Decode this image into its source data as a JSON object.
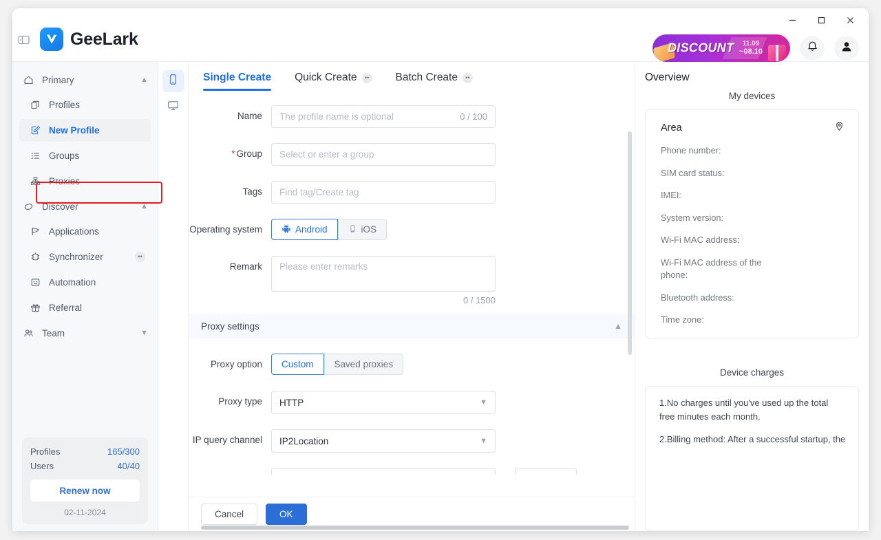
{
  "window": {
    "controls": {
      "minimize": "−",
      "maximize": "□",
      "close": "✕"
    }
  },
  "header": {
    "brand_name": "GeeLark",
    "promo": {
      "word": "DISCOUNT",
      "date_top": "11.09",
      "date_bottom": "~08.10"
    }
  },
  "sidebar": {
    "groups": [
      {
        "label": "Primary",
        "icon": "home-icon",
        "items": [
          {
            "label": "Profiles",
            "icon": "profiles-icon",
            "selected": false,
            "badge": ""
          },
          {
            "label": "New Profile",
            "icon": "new-profile-icon",
            "selected": true,
            "badge": ""
          },
          {
            "label": "Groups",
            "icon": "groups-icon",
            "selected": false,
            "badge": ""
          },
          {
            "label": "Proxies",
            "icon": "proxies-icon",
            "selected": false,
            "badge": ""
          }
        ]
      },
      {
        "label": "Discover",
        "icon": "discover-icon",
        "items": [
          {
            "label": "Applications",
            "icon": "applications-icon",
            "selected": false,
            "badge": ""
          },
          {
            "label": "Synchronizer",
            "icon": "synchronizer-icon",
            "selected": false,
            "badge": "••"
          },
          {
            "label": "Automation",
            "icon": "automation-icon",
            "selected": false,
            "badge": ""
          },
          {
            "label": "Referral",
            "icon": "referral-icon",
            "selected": false,
            "badge": ""
          }
        ]
      }
    ],
    "team": {
      "label": "Team",
      "icon": "team-icon"
    },
    "quota": {
      "profiles_label": "Profiles",
      "profiles_value": "165/300",
      "users_label": "Users",
      "users_value": "40/40",
      "renew_label": "Renew now",
      "date": "02-11-2024"
    }
  },
  "rail": {
    "phone_label": "phone-device",
    "desktop_label": "desktop-device"
  },
  "main": {
    "tabs": [
      {
        "label": "Single Create",
        "badge": "",
        "active": true
      },
      {
        "label": "Quick Create",
        "badge": "••",
        "active": false
      },
      {
        "label": "Batch Create",
        "badge": "••",
        "active": false
      }
    ],
    "fields": {
      "name": {
        "label": "Name",
        "placeholder": "The profile name is optional",
        "value": "",
        "counter": "0 / 100"
      },
      "group": {
        "label": "Group",
        "required": "*",
        "placeholder": "Select or enter a group",
        "value": ""
      },
      "tags": {
        "label": "Tags",
        "placeholder": "Find tag/Create tag",
        "value": ""
      },
      "os": {
        "label": "Operating system",
        "options": [
          {
            "label": "Android",
            "selected": true
          },
          {
            "label": "iOS",
            "selected": false
          }
        ]
      },
      "remark": {
        "label": "Remark",
        "placeholder": "Please enter remarks",
        "value": "",
        "counter": "0 / 1500"
      }
    },
    "proxy_section": {
      "title": "Proxy settings",
      "proxy_option": {
        "label": "Proxy option",
        "options": [
          {
            "label": "Custom",
            "selected": true
          },
          {
            "label": "Saved proxies",
            "selected": false
          }
        ]
      },
      "proxy_type": {
        "label": "Proxy type",
        "value": "HTTP"
      },
      "ip_query_channel": {
        "label": "IP query channel",
        "value": "IP2Location"
      }
    },
    "actions": {
      "cancel": "Cancel",
      "ok": "OK"
    }
  },
  "overview": {
    "title": "Overview",
    "devices_heading": "My devices",
    "area_label": "Area",
    "detail_lines": [
      "Phone number:",
      "SIM card status:",
      "IMEI:",
      "System version:",
      "Wi-Fi MAC address:",
      "Wi-Fi MAC address of the phone:",
      "Bluetooth address:",
      "Time zone:"
    ],
    "charges_heading": "Device charges",
    "charges_paragraphs": [
      "1.No charges until you've used up the total free minutes each month.",
      "2.Billing method: After a successful startup, the"
    ]
  },
  "colors": {
    "accent": "#1f6fe0",
    "primary_button": "#2b6fd6",
    "highlight_box": "#e8191b",
    "sidebar_bg": "#f7f8fa"
  }
}
